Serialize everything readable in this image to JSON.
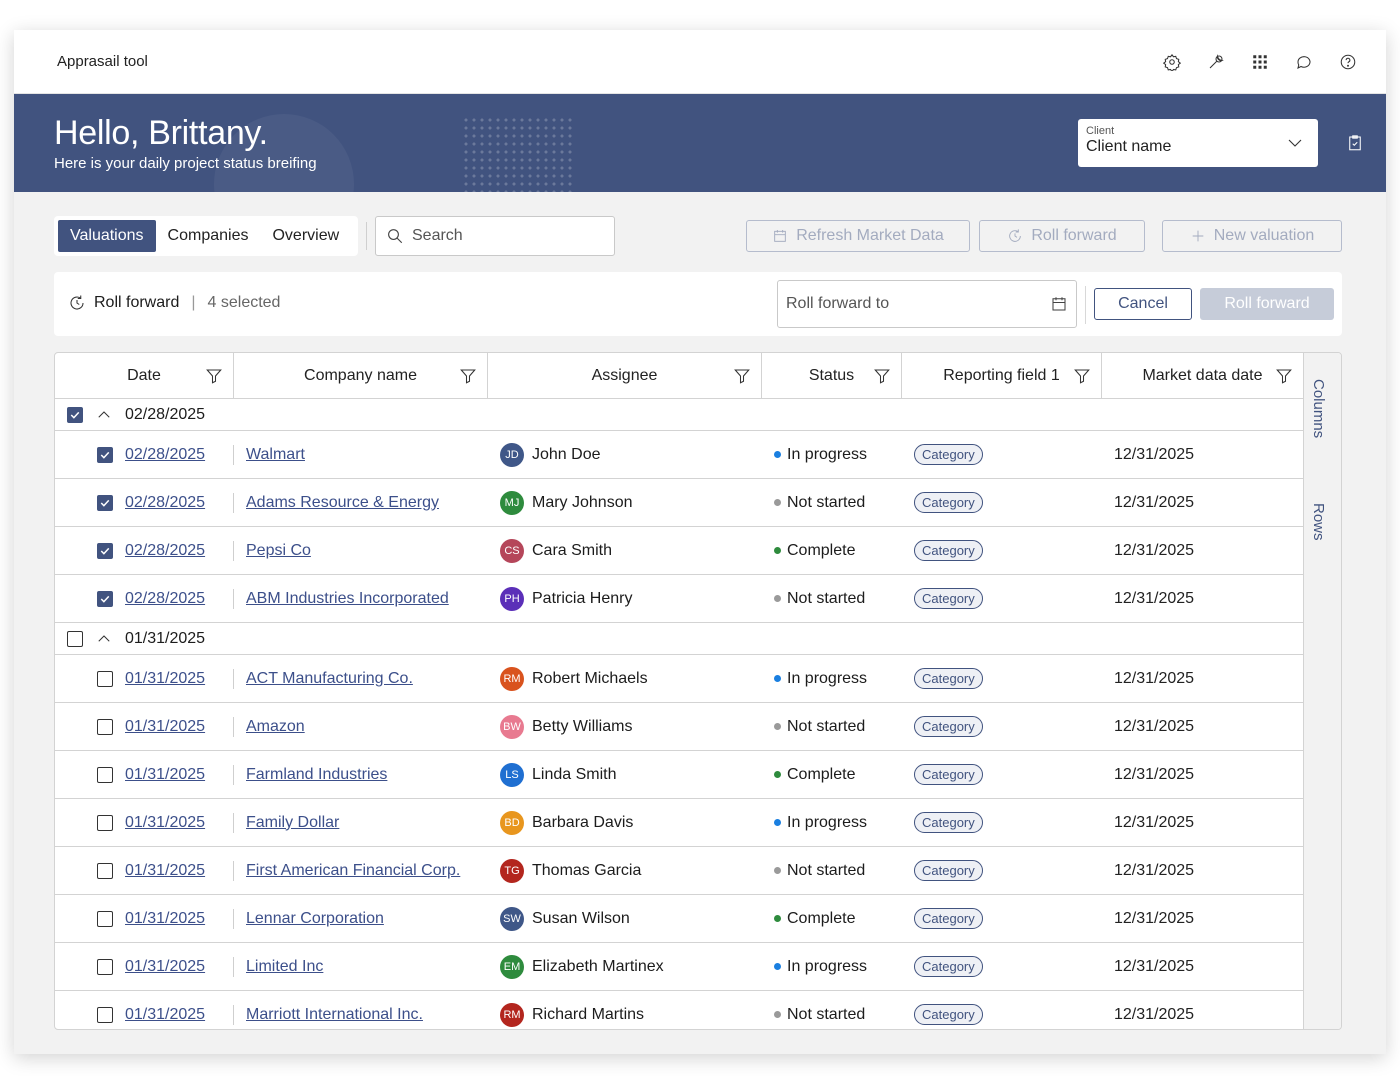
{
  "app": {
    "title": "Apprasail tool"
  },
  "hero": {
    "greeting": "Hello, Brittany.",
    "subtitle": "Here is your daily project status breifing"
  },
  "client": {
    "label": "Client",
    "value": "Client name"
  },
  "tabs": [
    {
      "label": "Valuations",
      "active": true
    },
    {
      "label": "Companies"
    },
    {
      "label": "Overview"
    }
  ],
  "search": {
    "placeholder": "Search"
  },
  "actions": {
    "refresh": "Refresh Market Data",
    "roll_forward": "Roll forward",
    "new_valuation": "New valuation"
  },
  "roll_bar": {
    "title": "Roll forward",
    "separator": "|",
    "selected": "4 selected",
    "date_placeholder": "Roll forward to",
    "cancel": "Cancel",
    "submit": "Roll forward"
  },
  "columns": {
    "date": "Date",
    "company": "Company name",
    "assignee": "Assignee",
    "status": "Status",
    "reporting": "Reporting field 1",
    "market": "Market data date"
  },
  "side_panel": {
    "columns": "Columns",
    "rows": "Rows"
  },
  "groups": [
    {
      "date": "02/28/2025",
      "checked": true,
      "rows": [
        {
          "date": "02/28/2025",
          "company": "Walmart",
          "initials": "JD",
          "avatar_color": "#3f5788",
          "assignee": "John Doe",
          "status": "In progress",
          "status_color": "#1a7fe0",
          "category": "Category",
          "market": "12/31/2025",
          "checked": true
        },
        {
          "date": "02/28/2025",
          "company": "Adams Resource & Energy",
          "initials": "MJ",
          "avatar_color": "#2e8b3d",
          "assignee": "Mary Johnson",
          "status": "Not started",
          "status_color": "#9a9a9a",
          "category": "Category",
          "market": "12/31/2025",
          "checked": true
        },
        {
          "date": "02/28/2025",
          "company": "Pepsi Co",
          "initials": "CS",
          "avatar_color": "#b5465a",
          "assignee": "Cara Smith",
          "status": "Complete",
          "status_color": "#2e8b3d",
          "category": "Category",
          "market": "12/31/2025",
          "checked": true
        },
        {
          "date": "02/28/2025",
          "company": "ABM Industries Incorporated",
          "initials": "PH",
          "avatar_color": "#5b2fb8",
          "assignee": "Patricia Henry",
          "status": "Not started",
          "status_color": "#9a9a9a",
          "category": "Category",
          "market": "12/31/2025",
          "checked": true
        }
      ]
    },
    {
      "date": "01/31/2025",
      "checked": false,
      "rows": [
        {
          "date": "01/31/2025",
          "company": "ACT Manufacturing Co.",
          "initials": "RM",
          "avatar_color": "#d9531e",
          "assignee": "Robert Michaels",
          "status": "In progress",
          "status_color": "#1a7fe0",
          "category": "Category",
          "market": "12/31/2025",
          "checked": false
        },
        {
          "date": "01/31/2025",
          "company": "Amazon",
          "initials": "BW",
          "avatar_color": "#e87a90",
          "assignee": "Betty Williams",
          "status": "Not started",
          "status_color": "#9a9a9a",
          "category": "Category",
          "market": "12/31/2025",
          "checked": false
        },
        {
          "date": "01/31/2025",
          "company": "Farmland Industries",
          "initials": "LS",
          "avatar_color": "#1f6fd1",
          "assignee": "Linda Smith",
          "status": "Complete",
          "status_color": "#2e8b3d",
          "category": "Category",
          "market": "12/31/2025",
          "checked": false
        },
        {
          "date": "01/31/2025",
          "company": "Family Dollar",
          "initials": "BD",
          "avatar_color": "#e8961e",
          "assignee": "Barbara Davis",
          "status": "In progress",
          "status_color": "#1a7fe0",
          "category": "Category",
          "market": "12/31/2025",
          "checked": false
        },
        {
          "date": "01/31/2025",
          "company": "First American Financial Corp.",
          "initials": "TG",
          "avatar_color": "#b3261e",
          "assignee": "Thomas Garcia",
          "status": "Not started",
          "status_color": "#9a9a9a",
          "category": "Category",
          "market": "12/31/2025",
          "checked": false
        },
        {
          "date": "01/31/2025",
          "company": "Lennar Corporation",
          "initials": "SW",
          "avatar_color": "#3f5788",
          "assignee": "Susan Wilson",
          "status": "Complete",
          "status_color": "#2e8b3d",
          "category": "Category",
          "market": "12/31/2025",
          "checked": false
        },
        {
          "date": "01/31/2025",
          "company": "Limited Inc",
          "initials": "EM",
          "avatar_color": "#2e8b3d",
          "assignee": "Elizabeth Martinex",
          "status": "In progress",
          "status_color": "#1a7fe0",
          "category": "Category",
          "market": "12/31/2025",
          "checked": false
        },
        {
          "date": "01/31/2025",
          "company": "Marriott International Inc.",
          "initials": "RM",
          "avatar_color": "#b3261e",
          "assignee": "Richard Martins",
          "status": "Not started",
          "status_color": "#9a9a9a",
          "category": "Category",
          "market": "12/31/2025",
          "checked": false
        }
      ]
    }
  ],
  "colors": {
    "brand": "#41537f",
    "link": "#3c4f8a"
  }
}
